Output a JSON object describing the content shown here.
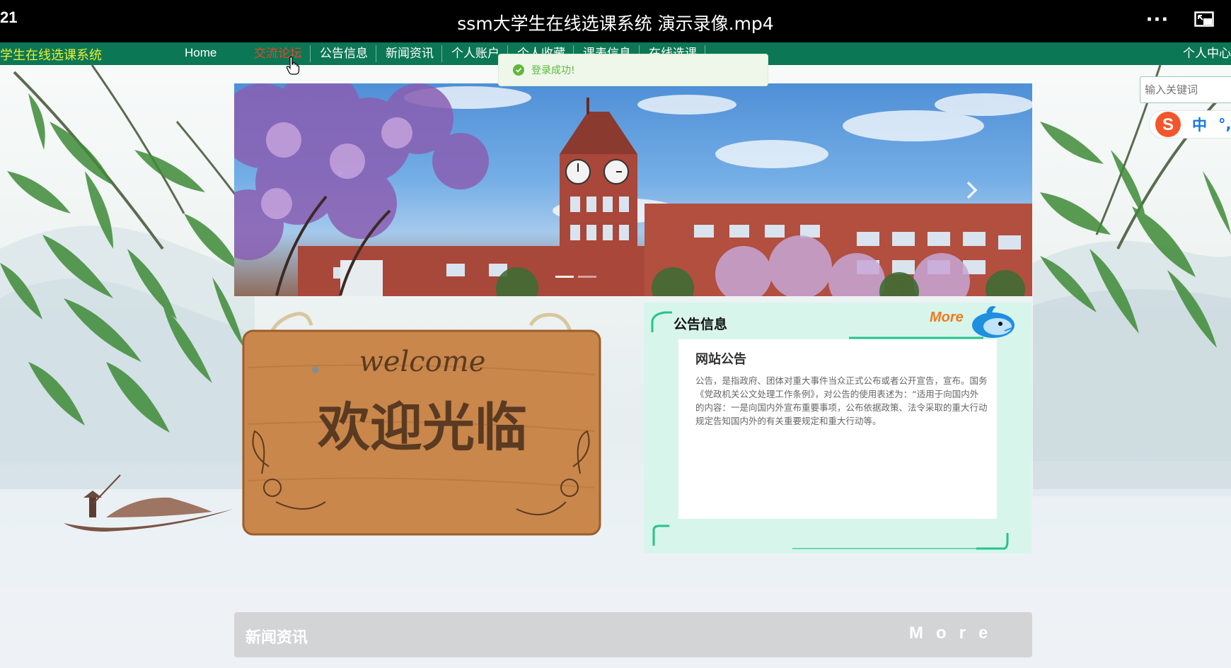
{
  "player": {
    "time": "21",
    "title": "ssm大学生在线选课系统 演示录像.mp4",
    "more_label": "···"
  },
  "nav": {
    "brand": "学生在线选课系统",
    "home": "Home",
    "items": [
      {
        "label": "交流论坛",
        "active": true
      },
      {
        "label": "公告信息",
        "active": false
      },
      {
        "label": "新闻资讯",
        "active": false
      },
      {
        "label": "个人账户",
        "active": false
      },
      {
        "label": "个人收藏",
        "active": false
      },
      {
        "label": "课表信息",
        "active": false
      },
      {
        "label": "在线选课",
        "active": false
      }
    ],
    "user_center": "个人中心"
  },
  "toast": {
    "message": "登录成功!"
  },
  "search": {
    "placeholder": "输入关键词"
  },
  "ime": {
    "logo": "S",
    "mode": "中",
    "punct": "°,"
  },
  "welcome_board": {
    "en": "welcome",
    "zh": "欢迎光临"
  },
  "notice": {
    "heading": "公告信息",
    "more": "More",
    "card_title": "网站公告",
    "lines": [
      "公告，是指政府、团体对重大事件当众正式公布或者公开宣告，宣布。国务",
      "《党政机关公文处理工作条例》，对公告的使用表述为：“适用于向国内外",
      "的内容：一是向国内外宣布重要事项，公布依据政策、法令采取的重大行动",
      "规定告知国内外的有关重要规定和重大行动等。"
    ]
  },
  "news": {
    "title": "新闻资讯",
    "more": "More"
  },
  "colors": {
    "nav_bg": "#0c7754",
    "brand": "#e8ef34",
    "active_nav": "#e5472c",
    "toast_text": "#5fb83b",
    "notice_bg": "#d8f5ec",
    "more_orange": "#f07a1c",
    "news_bar": "#d3d4d6"
  }
}
